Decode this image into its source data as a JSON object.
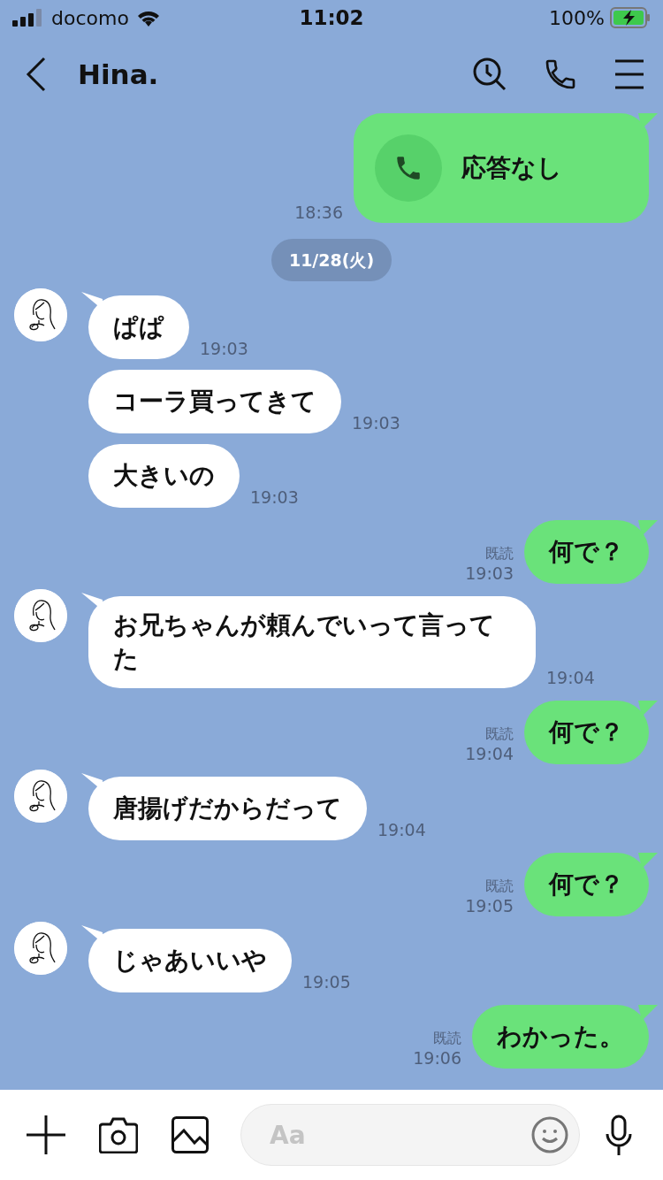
{
  "status_bar": {
    "carrier": "docomo",
    "time": "11:02",
    "battery": "100%"
  },
  "header": {
    "title": "Hina."
  },
  "messages": [
    {
      "kind": "call",
      "text": "応答なし",
      "time": "18:36"
    },
    {
      "kind": "date",
      "text": "11/28(火)"
    },
    {
      "kind": "received",
      "bubbles": [
        {
          "text": "ぱぱ",
          "time": "19:03"
        },
        {
          "text": "コーラ買ってきて",
          "time": "19:03"
        },
        {
          "text": "大きいの",
          "time": "19:03"
        }
      ]
    },
    {
      "kind": "sent",
      "read": "既読",
      "text": "何で？",
      "time": "19:03"
    },
    {
      "kind": "received",
      "bubbles": [
        {
          "text": "お兄ちゃんが頼んでいって言ってた",
          "time": "19:04"
        }
      ]
    },
    {
      "kind": "sent",
      "read": "既読",
      "text": "何で？",
      "time": "19:04"
    },
    {
      "kind": "received",
      "bubbles": [
        {
          "text": "唐揚げだからだって",
          "time": "19:04"
        }
      ]
    },
    {
      "kind": "sent",
      "read": "既読",
      "text": "何で？",
      "time": "19:05"
    },
    {
      "kind": "received",
      "bubbles": [
        {
          "text": "じゃあいいや",
          "time": "19:05"
        }
      ]
    },
    {
      "kind": "sent",
      "read": "既読",
      "text": "わかった。",
      "time": "19:06"
    }
  ],
  "composer": {
    "placeholder": "Aa"
  }
}
